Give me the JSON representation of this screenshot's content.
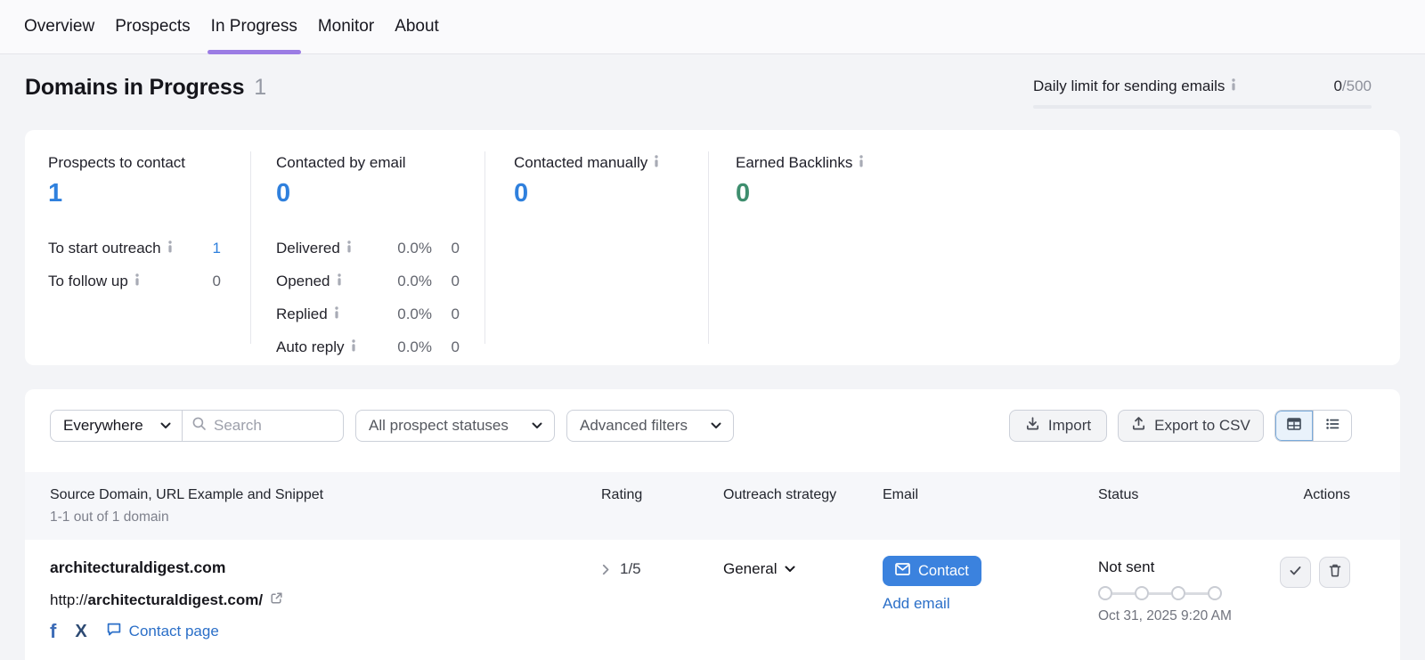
{
  "colors": {
    "accent_purple": "#9b7ce4",
    "stat_blue": "#2f80dd",
    "stat_green": "#3e8e6e",
    "link_blue": "#2b6fc8",
    "contact_button_blue": "#3b82de"
  },
  "tabs": [
    {
      "label": "Overview",
      "active": false
    },
    {
      "label": "Prospects",
      "active": false
    },
    {
      "label": "In Progress",
      "active": true
    },
    {
      "label": "Monitor",
      "active": false
    },
    {
      "label": "About",
      "active": false
    }
  ],
  "header": {
    "title": "Domains in Progress",
    "count": "1",
    "daily_limit": {
      "label": "Daily limit for sending emails",
      "used": "0",
      "total": "/500"
    }
  },
  "stats": {
    "prospects": {
      "title": "Prospects to contact",
      "value": "1",
      "rows": [
        {
          "label": "To start outreach",
          "value": "1"
        },
        {
          "label": "To follow up",
          "value": "0"
        }
      ]
    },
    "contacted_email": {
      "title": "Contacted by email",
      "value": "0",
      "rows": [
        {
          "label": "Delivered",
          "pct": "0.0%",
          "count": "0"
        },
        {
          "label": "Opened",
          "pct": "0.0%",
          "count": "0"
        },
        {
          "label": "Replied",
          "pct": "0.0%",
          "count": "0"
        },
        {
          "label": "Auto reply",
          "pct": "0.0%",
          "count": "0"
        }
      ]
    },
    "contacted_manually": {
      "title": "Contacted manually",
      "value": "0"
    },
    "earned_backlinks": {
      "title": "Earned Backlinks",
      "value": "0"
    }
  },
  "toolbar": {
    "scope": "Everywhere",
    "search_placeholder": "Search",
    "status_filter": "All prospect statuses",
    "advanced_filters": "Advanced filters",
    "import_label": "Import",
    "export_label": "Export to CSV"
  },
  "table": {
    "headers": {
      "source": "Source Domain, URL Example and Snippet",
      "rating": "Rating",
      "strategy": "Outreach strategy",
      "email": "Email",
      "status": "Status",
      "actions": "Actions"
    },
    "count_text": "1-1 out of 1 domain",
    "row": {
      "domain": "architecturaldigest.com",
      "url_prefix": "http://",
      "url_domain": "architecturaldigest.com/",
      "contact_page_label": "Contact page",
      "rating": "1/5",
      "strategy": "General",
      "contact_button": "Contact",
      "add_email": "Add email",
      "status": "Not sent",
      "date": "Oct 31, 2025 9:20 AM"
    }
  },
  "icons": {
    "facebook": "f",
    "x_logo": "X"
  }
}
